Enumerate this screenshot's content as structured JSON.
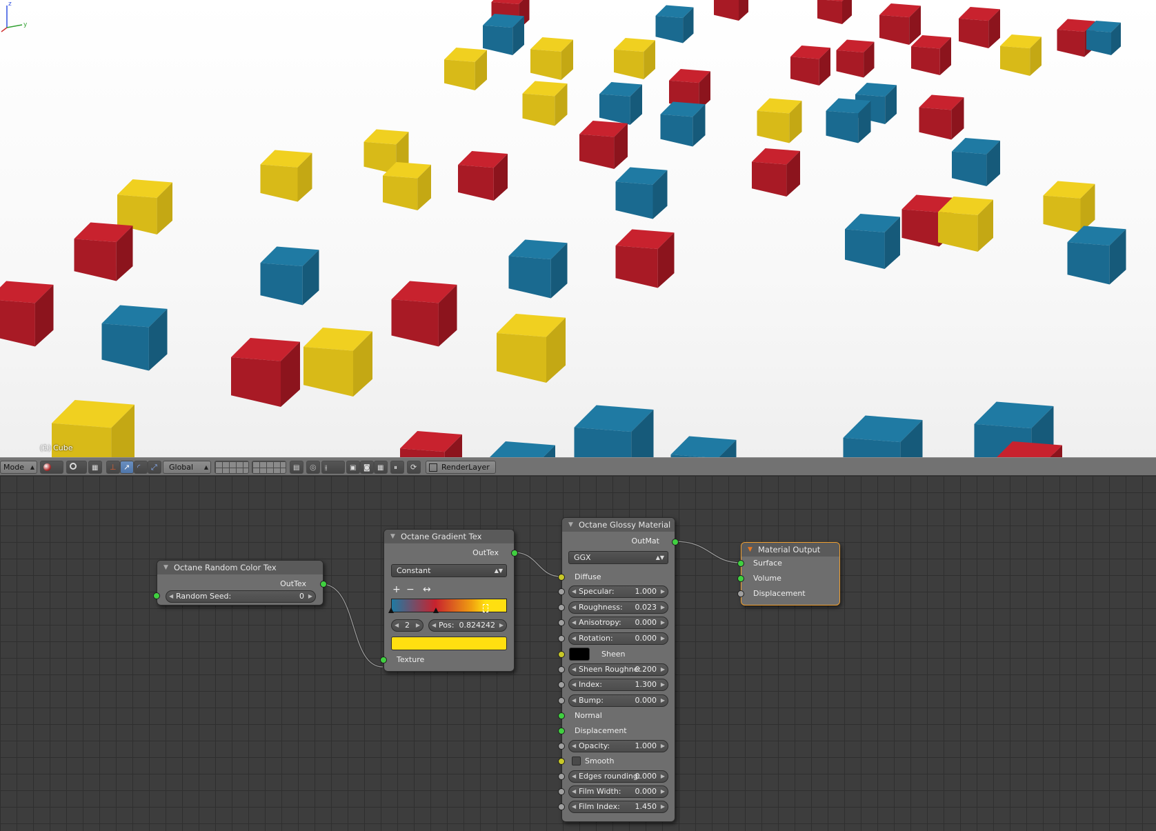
{
  "viewport": {
    "object_label": "(1) Cube",
    "axes": {
      "x": "x",
      "y": "y",
      "z": "z"
    }
  },
  "header": {
    "mode_label": "Mode",
    "orientation_label": "Global",
    "render_layer_label": "RenderLayer"
  },
  "nodes": {
    "random_color": {
      "title": "Octane Random Color Tex",
      "output": "OutTex",
      "seed_label": "Random Seed:",
      "seed_value": "0"
    },
    "gradient": {
      "title": "Octane Gradient Tex",
      "output": "OutTex",
      "interpolation": "Constant",
      "add_label": "+",
      "remove_label": "−",
      "flip_label": "↔",
      "active_stop": "2",
      "pos_label": "Pos:",
      "pos_value": "0.824242",
      "input_texture": "Texture",
      "stop_color": "#ffdf10"
    },
    "glossy": {
      "title": "Octane Glossy Material",
      "output": "OutMat",
      "brdf": "GGX",
      "diffuse": "Diffuse",
      "specular_label": "Specular:",
      "specular_value": "1.000",
      "roughness_label": "Roughness:",
      "roughness_value": "0.023",
      "anisotropy_label": "Anisotropy:",
      "anisotropy_value": "0.000",
      "rotation_label": "Rotation:",
      "rotation_value": "0.000",
      "sheen_label": "Sheen",
      "sheen_roughness_label": "Sheen Roughne:",
      "sheen_roughness_value": "0.200",
      "index_label": "Index:",
      "index_value": "1.300",
      "bump_label": "Bump:",
      "bump_value": "0.000",
      "normal": "Normal",
      "displacement": "Displacement",
      "opacity_label": "Opacity:",
      "opacity_value": "1.000",
      "smooth_label": "Smooth",
      "edges_label": "Edges rounding:",
      "edges_value": "0.000",
      "film_width_label": "Film Width:",
      "film_width_value": "0.000",
      "film_index_label": "Film Index:",
      "film_index_value": "1.450"
    },
    "output": {
      "title": "Material Output",
      "surface": "Surface",
      "volume": "Volume",
      "displacement": "Displacement"
    }
  },
  "colors": {
    "cube_red": "#c8222e",
    "cube_blue": "#1f7aa3",
    "cube_yellow": "#f0d020",
    "selection_outline": "#f0a030",
    "socket_green": "#40d040",
    "socket_yellow": "#c8c828",
    "socket_grey": "#a0a0a0"
  }
}
